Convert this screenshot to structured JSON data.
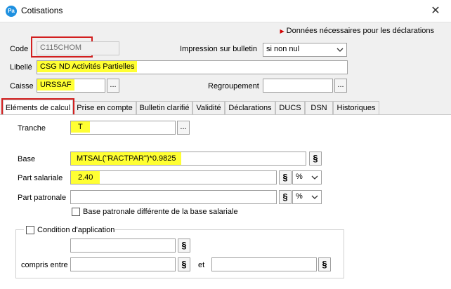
{
  "window": {
    "app_badge": "Pa",
    "title": "Cotisations",
    "close_glyph": "✕"
  },
  "note": "Données nécessaires pour les déclarations",
  "form": {
    "code_label": "Code",
    "code_value": "C115CHOM",
    "impression_label": "Impression sur bulletin",
    "impression_value": "si non nul",
    "libelle_label": "Libellé",
    "libelle_value": "CSG ND Activités Partielles",
    "caisse_label": "Caisse",
    "caisse_value": "URSSAF",
    "regroupement_label": "Regroupement",
    "regroupement_value": "",
    "dots": "..."
  },
  "tabs": [
    {
      "label": "Eléments de calcul",
      "active": true
    },
    {
      "label": "Prise en compte"
    },
    {
      "label": "Bulletin clarifié"
    },
    {
      "label": "Validité"
    },
    {
      "label": "Déclarations"
    },
    {
      "label": "DUCS"
    },
    {
      "label": "DSN"
    },
    {
      "label": "Historiques"
    }
  ],
  "calc": {
    "tranche_label": "Tranche",
    "tranche_value": "T",
    "base_label": "Base",
    "base_value": "MTSAL(\"RACTPAR\")*0.9825",
    "part_salariale_label": "Part salariale",
    "part_salariale_value": "2.40",
    "part_salariale_unit": "%",
    "part_patronale_label": "Part patronale",
    "part_patronale_value": "",
    "part_patronale_unit": "%",
    "base_patronale_diff_label": "Base patronale différente de la base salariale",
    "condition_label": "Condition d'application",
    "compris_entre_label": "compris entre",
    "et_label": "et",
    "dollar": "§"
  },
  "colors": {
    "highlight": "#ffff33",
    "red_box": "#d21f1f",
    "app_icon": "#1e90e0"
  }
}
